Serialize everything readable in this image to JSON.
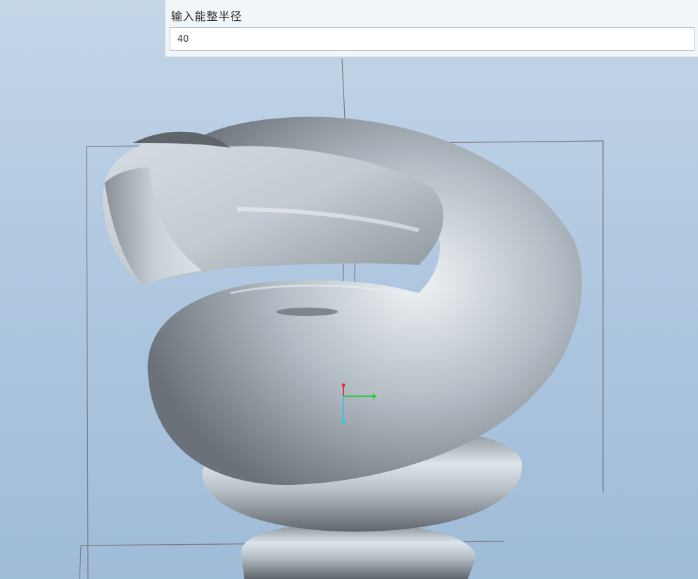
{
  "prompt": {
    "label": "输入能整半径",
    "value": "40"
  },
  "viewport": {
    "background_top": "#c4d6e8",
    "background_bottom": "#9fbcd8",
    "model_color": "#b8c2ca",
    "datum_line_color": "#7a7a7a",
    "axis_x_color": "#2ecc40",
    "axis_y_color": "#e03030",
    "axis_z_color": "#30c8e0"
  }
}
